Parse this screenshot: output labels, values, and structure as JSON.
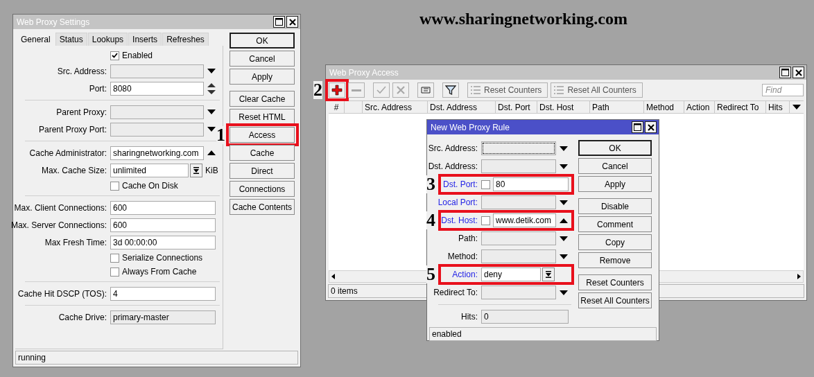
{
  "banner": "www.sharingnetworking.com",
  "settings_window": {
    "title": "Web Proxy Settings",
    "active": false,
    "tabs": [
      {
        "label": "General",
        "selected": true
      },
      {
        "label": "Status",
        "selected": false
      },
      {
        "label": "Lookups",
        "selected": false
      },
      {
        "label": "Inserts",
        "selected": false
      },
      {
        "label": "Refreshes",
        "selected": false
      }
    ],
    "rows": [
      {
        "kind": "checkbox",
        "label": "Enabled",
        "checked": true
      },
      {
        "kind": "dropdown",
        "label": "Src. Address:",
        "disabled": true,
        "expanded": false
      },
      {
        "kind": "spin",
        "label": "Port:",
        "value": "8080",
        "disabled": false
      },
      {
        "kind": "separator"
      },
      {
        "kind": "dropdown",
        "label": "Parent Proxy:",
        "disabled": true,
        "expanded": false
      },
      {
        "kind": "dropdown",
        "label": "Parent Proxy Port:",
        "disabled": true,
        "expanded": false
      },
      {
        "kind": "separator"
      },
      {
        "kind": "dropdown",
        "label": "Cache Administrator:",
        "value": "sharingnetworking.com",
        "disabled": false,
        "expanded": true
      },
      {
        "kind": "select",
        "label": "Max. Cache Size:",
        "value": "unlimited",
        "unit": "KiB",
        "disabled": false
      },
      {
        "kind": "checkbox",
        "label": "Cache On Disk",
        "checked": false
      },
      {
        "kind": "separator"
      },
      {
        "kind": "text",
        "label": "Max. Client Connections:",
        "value": "600",
        "disabled": false
      },
      {
        "kind": "text",
        "label": "Max. Server Connections:",
        "value": "600",
        "disabled": false
      },
      {
        "kind": "text",
        "label": "Max Fresh Time:",
        "value": "3d 00:00:00",
        "disabled": false
      },
      {
        "kind": "checkbox",
        "label": "Serialize Connections",
        "checked": false
      },
      {
        "kind": "checkbox",
        "label": "Always From Cache",
        "checked": false
      },
      {
        "kind": "separator"
      },
      {
        "kind": "text",
        "label": "Cache Hit DSCP (TOS):",
        "value": "4",
        "disabled": false
      },
      {
        "kind": "separator"
      },
      {
        "kind": "text",
        "label": "Cache Drive:",
        "value": "primary-master",
        "disabled": true
      }
    ],
    "button_groups": [
      [
        {
          "label": "OK",
          "default": true,
          "highlighted": false
        },
        {
          "label": "Cancel",
          "default": false,
          "highlighted": false
        },
        {
          "label": "Apply",
          "default": false,
          "highlighted": false
        }
      ],
      [
        {
          "label": "Clear Cache",
          "default": false,
          "highlighted": false
        },
        {
          "label": "Reset HTML",
          "default": false,
          "highlighted": false
        },
        {
          "label": "Access",
          "default": false,
          "highlighted": true,
          "step": "1"
        },
        {
          "label": "Cache",
          "default": false,
          "highlighted": false
        },
        {
          "label": "Direct",
          "default": false,
          "highlighted": false
        },
        {
          "label": "Connections",
          "default": false,
          "highlighted": false
        },
        {
          "label": "Cache Contents",
          "default": false,
          "highlighted": false
        }
      ]
    ],
    "status": "running"
  },
  "access_window": {
    "title": "Web Proxy Access",
    "active": false,
    "tools": [
      {
        "kind": "add",
        "disabled": false,
        "highlighted": true,
        "step": "2"
      },
      {
        "kind": "remove",
        "disabled": true,
        "highlighted": false
      },
      {
        "kind": "enable",
        "disabled": true,
        "highlighted": false
      },
      {
        "kind": "disable",
        "disabled": true,
        "highlighted": false
      },
      {
        "kind": "comment",
        "disabled": false,
        "highlighted": false
      },
      {
        "kind": "filter",
        "disabled": false,
        "highlighted": false
      }
    ],
    "text_tools": [
      {
        "label": "Reset Counters"
      },
      {
        "label": "Reset All Counters"
      }
    ],
    "find": {
      "placeholder": "Find"
    },
    "columns": [
      "#",
      "Src. Address",
      "Dst. Address",
      "Dst. Port",
      "Dst. Host",
      "Path",
      "Method",
      "Action",
      "Redirect To",
      "Hits"
    ],
    "status": "0 items"
  },
  "rule_window": {
    "title": "New Web Proxy Rule",
    "active": true,
    "rows": [
      {
        "kind": "dropdown",
        "label": "Src. Address:",
        "link": false,
        "disabled": true,
        "focused": true,
        "expanded": false,
        "highlighted": false
      },
      {
        "kind": "dropdown",
        "label": "Dst. Address:",
        "link": false,
        "disabled": true,
        "focused": false,
        "expanded": false,
        "highlighted": false
      },
      {
        "kind": "negatable",
        "label": "Dst. Port:",
        "value": "80",
        "link": true,
        "negated": false,
        "disabled": false,
        "focused": false,
        "highlighted": true,
        "step": "3"
      },
      {
        "kind": "dropdown",
        "label": "Local Port:",
        "link": true,
        "disabled": true,
        "focused": false,
        "expanded": false,
        "highlighted": false
      },
      {
        "kind": "negatable",
        "label": "Dst. Host:",
        "value": "www.detik.com",
        "link": true,
        "negated": false,
        "disabled": false,
        "focused": false,
        "expanded": true,
        "highlighted": true,
        "step": "4"
      },
      {
        "kind": "dropdown",
        "label": "Path:",
        "link": false,
        "disabled": true,
        "focused": false,
        "expanded": false,
        "highlighted": false
      },
      {
        "kind": "dropdown",
        "label": "Method:",
        "link": false,
        "disabled": true,
        "focused": false,
        "expanded": false,
        "highlighted": false
      },
      {
        "kind": "select",
        "label": "Action:",
        "value": "deny",
        "link": true,
        "disabled": false,
        "focused": false,
        "highlighted": true,
        "step": "5"
      },
      {
        "kind": "dropdown",
        "label": "Redirect To:",
        "link": false,
        "disabled": true,
        "focused": false,
        "expanded": false,
        "highlighted": false
      },
      {
        "kind": "separator"
      },
      {
        "kind": "text",
        "label": "Hits:",
        "value": "0",
        "link": false,
        "disabled": true,
        "focused": false,
        "highlighted": false
      }
    ],
    "button_groups": [
      [
        {
          "label": "OK",
          "default": true,
          "highlighted": false
        },
        {
          "label": "Cancel",
          "default": false,
          "highlighted": false
        },
        {
          "label": "Apply",
          "default": false,
          "highlighted": false
        }
      ],
      [
        {
          "label": "Disable",
          "default": false,
          "highlighted": false
        },
        {
          "label": "Comment",
          "default": false,
          "highlighted": false
        },
        {
          "label": "Copy",
          "default": false,
          "highlighted": false
        },
        {
          "label": "Remove",
          "default": false,
          "highlighted": false
        }
      ],
      [
        {
          "label": "Reset Counters",
          "default": false,
          "highlighted": false
        },
        {
          "label": "Reset All Counters",
          "default": false,
          "highlighted": false
        }
      ]
    ],
    "status": "enabled"
  }
}
